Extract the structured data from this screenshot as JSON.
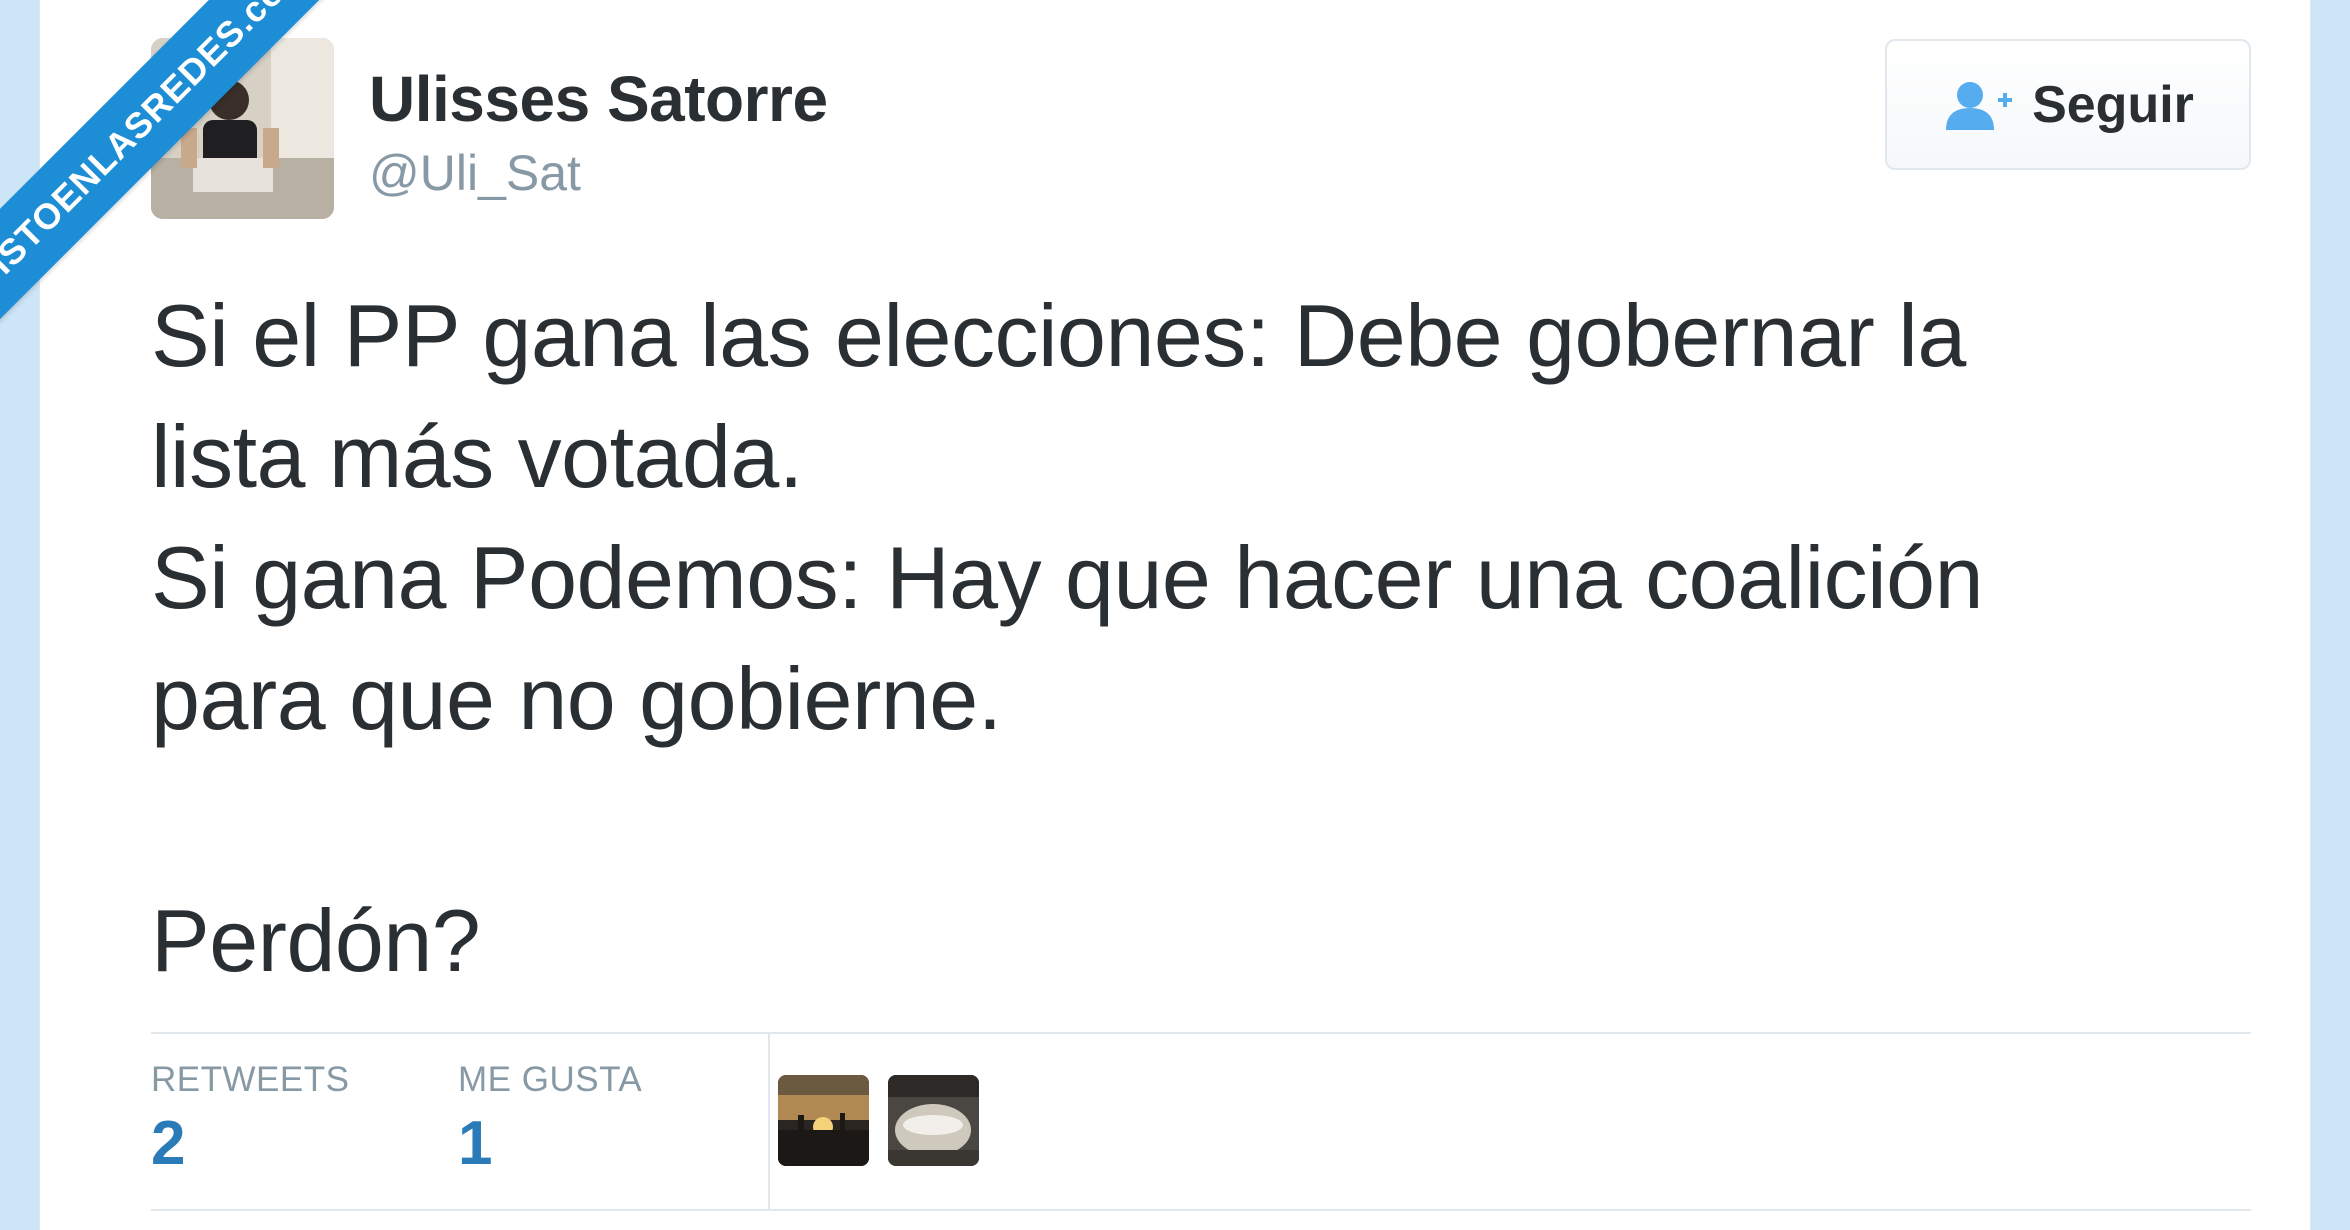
{
  "watermark": {
    "text": "VISTOENLASREDES.com"
  },
  "profile": {
    "display_name": "Ulisses Satorre",
    "handle": "@Uli_Sat",
    "avatar_icon": "user-photo"
  },
  "follow_button": {
    "label": "Seguir",
    "icon": "add-user-icon"
  },
  "tweet": {
    "lines": [
      "Si el PP gana las elecciones: Debe gobernar la",
      "lista más votada.",
      "Si gana Podemos: Hay que hacer una coalición",
      "para que no gobierne.",
      "",
      "Perdón?"
    ]
  },
  "stats": {
    "retweets": {
      "label": "RETWEETS",
      "value": "2"
    },
    "likes": {
      "label": "ME GUSTA",
      "value": "1"
    }
  },
  "colors": {
    "background": "#cde6f7",
    "text": "#292f33",
    "secondary_text": "#8899a6",
    "stat_value": "#2b7bb9",
    "follow_icon": "#55acee",
    "watermark": "#1d8dd6"
  }
}
